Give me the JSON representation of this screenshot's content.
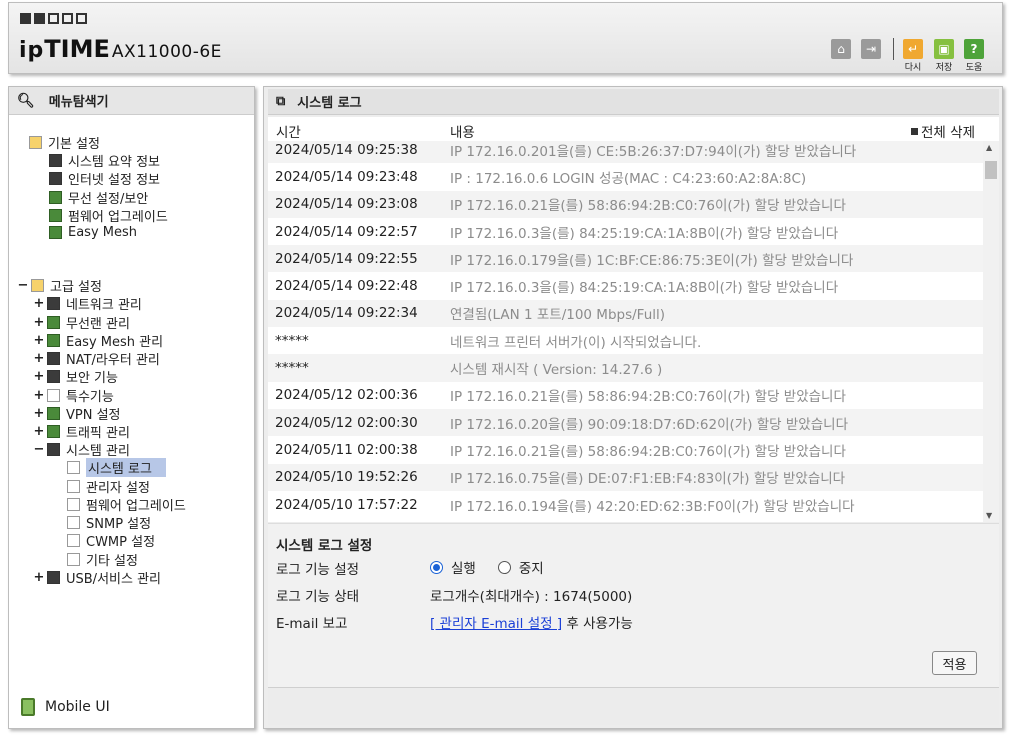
{
  "header": {
    "brand_prefix": "ip",
    "brand_bold": "TIME",
    "model": "AX11000-6E",
    "buttons": {
      "refresh_label": "다시",
      "save_label": "저장",
      "help_label": "도움"
    }
  },
  "sidebar": {
    "title": "메뉴탐색기",
    "basic": {
      "label": "기본 설정",
      "items": [
        "시스템 요약 정보",
        "인터넷 설정 정보",
        "무선 설정/보안",
        "펌웨어 업그레이드",
        "Easy Mesh"
      ]
    },
    "advanced": {
      "label": "고급 설정",
      "items": [
        "네트워크 관리",
        "무선랜 관리",
        "Easy Mesh 관리",
        "NAT/라우터 관리",
        "보안 기능",
        "특수기능",
        "VPN 설정",
        "트래픽 관리",
        "시스템 관리"
      ],
      "system_subitems": [
        "시스템 로그",
        "관리자 설정",
        "펌웨어 업그레이드",
        "SNMP 설정",
        "CWMP 설정",
        "기타 설정"
      ],
      "last_item": "USB/서비스 관리"
    },
    "mobile_label": "Mobile UI"
  },
  "main": {
    "title": "시스템 로그",
    "columns": {
      "time": "시간",
      "content": "내용",
      "delete_all": "전체 삭제"
    },
    "logs": [
      {
        "time": "2024/05/14 09:25:38",
        "msg": "IP 172.16.0.201을(를) CE:5B:26:37:D7:94이(가) 할당 받았습니다"
      },
      {
        "time": "2024/05/14 09:23:48",
        "msg": "IP : 172.16.0.6 LOGIN 성공(MAC : C4:23:60:A2:8A:8C)"
      },
      {
        "time": "2024/05/14 09:23:08",
        "msg": "IP 172.16.0.21을(를) 58:86:94:2B:C0:76이(가) 할당 받았습니다"
      },
      {
        "time": "2024/05/14 09:22:57",
        "msg": "IP 172.16.0.3을(를) 84:25:19:CA:1A:8B이(가) 할당 받았습니다"
      },
      {
        "time": "2024/05/14 09:22:55",
        "msg": "IP 172.16.0.179을(를) 1C:BF:CE:86:75:3E이(가) 할당 받았습니다"
      },
      {
        "time": "2024/05/14 09:22:48",
        "msg": "IP 172.16.0.3을(를) 84:25:19:CA:1A:8B이(가) 할당 받았습니다"
      },
      {
        "time": "2024/05/14 09:22:34",
        "msg": "연결됨(LAN 1 포트/100 Mbps/Full)"
      },
      {
        "time": "*****",
        "msg": "네트워크 프린터 서버가(이) 시작되었습니다."
      },
      {
        "time": "*****",
        "msg": "시스템 재시작 ( Version: 14.27.6 )"
      },
      {
        "time": "2024/05/12 02:00:36",
        "msg": "IP 172.16.0.21을(를) 58:86:94:2B:C0:76이(가) 할당 받았습니다"
      },
      {
        "time": "2024/05/12 02:00:30",
        "msg": "IP 172.16.0.20을(를) 90:09:18:D7:6D:62이(가) 할당 받았습니다"
      },
      {
        "time": "2024/05/11 02:00:38",
        "msg": "IP 172.16.0.21을(를) 58:86:94:2B:C0:76이(가) 할당 받았습니다"
      },
      {
        "time": "2024/05/10 19:52:26",
        "msg": "IP 172.16.0.75을(를) DE:07:F1:EB:F4:83이(가) 할당 받았습니다"
      },
      {
        "time": "2024/05/10 17:57:22",
        "msg": "IP 172.16.0.194을(를) 42:20:ED:62:3B:F0이(가) 할당 받았습니다"
      }
    ],
    "settings": {
      "title": "시스템 로그 설정",
      "log_function_label": "로그 기능 설정",
      "run_label": "실행",
      "stop_label": "중지",
      "log_status_label": "로그 기능 상태",
      "log_status_value": "로그개수(최대개수) : 1674(5000)",
      "email_label": "E-mail 보고",
      "email_link": "[ 관리자 E-mail 설정 ]",
      "email_suffix": " 후 사용가능",
      "apply_label": "적용"
    }
  }
}
